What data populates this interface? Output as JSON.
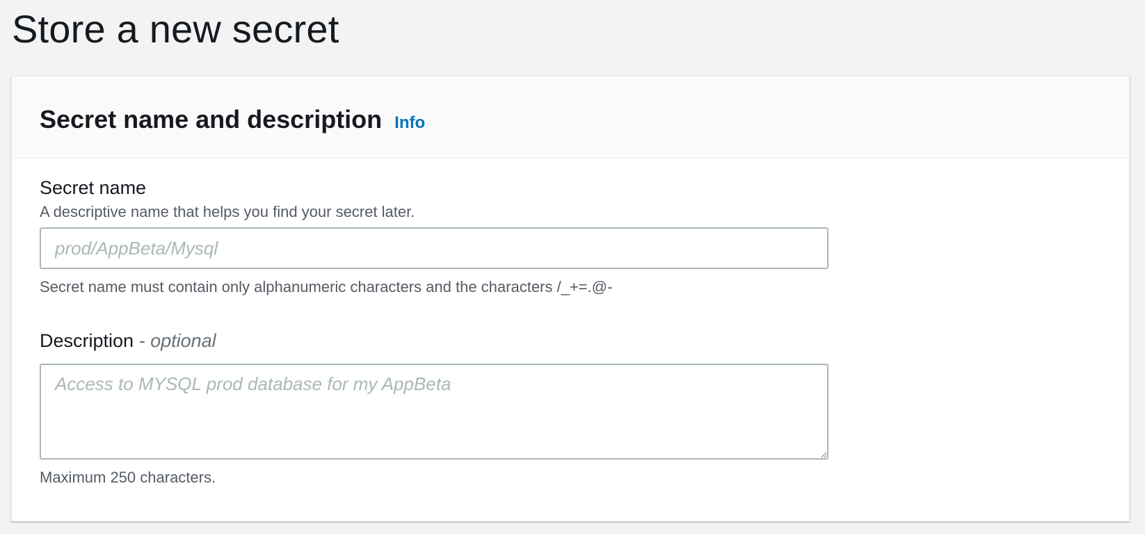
{
  "page": {
    "title": "Store a new secret"
  },
  "panel": {
    "title": "Secret name and description",
    "info_label": "Info"
  },
  "secret_name": {
    "label": "Secret name",
    "description": "A descriptive name that helps you find your secret later.",
    "value": "",
    "placeholder": "prod/AppBeta/Mysql",
    "constraint": "Secret name must contain only alphanumeric characters and the characters /_+=.@-"
  },
  "description_field": {
    "label": "Description",
    "optional_label": "- optional",
    "value": "",
    "placeholder": "Access to MYSQL prod database for my AppBeta",
    "constraint": "Maximum 250 characters."
  },
  "colors": {
    "link": "#0073bb",
    "text": "#16191f",
    "secondary_text": "#545b64",
    "input_border": "#aab7b8",
    "background": "#f2f3f3"
  }
}
